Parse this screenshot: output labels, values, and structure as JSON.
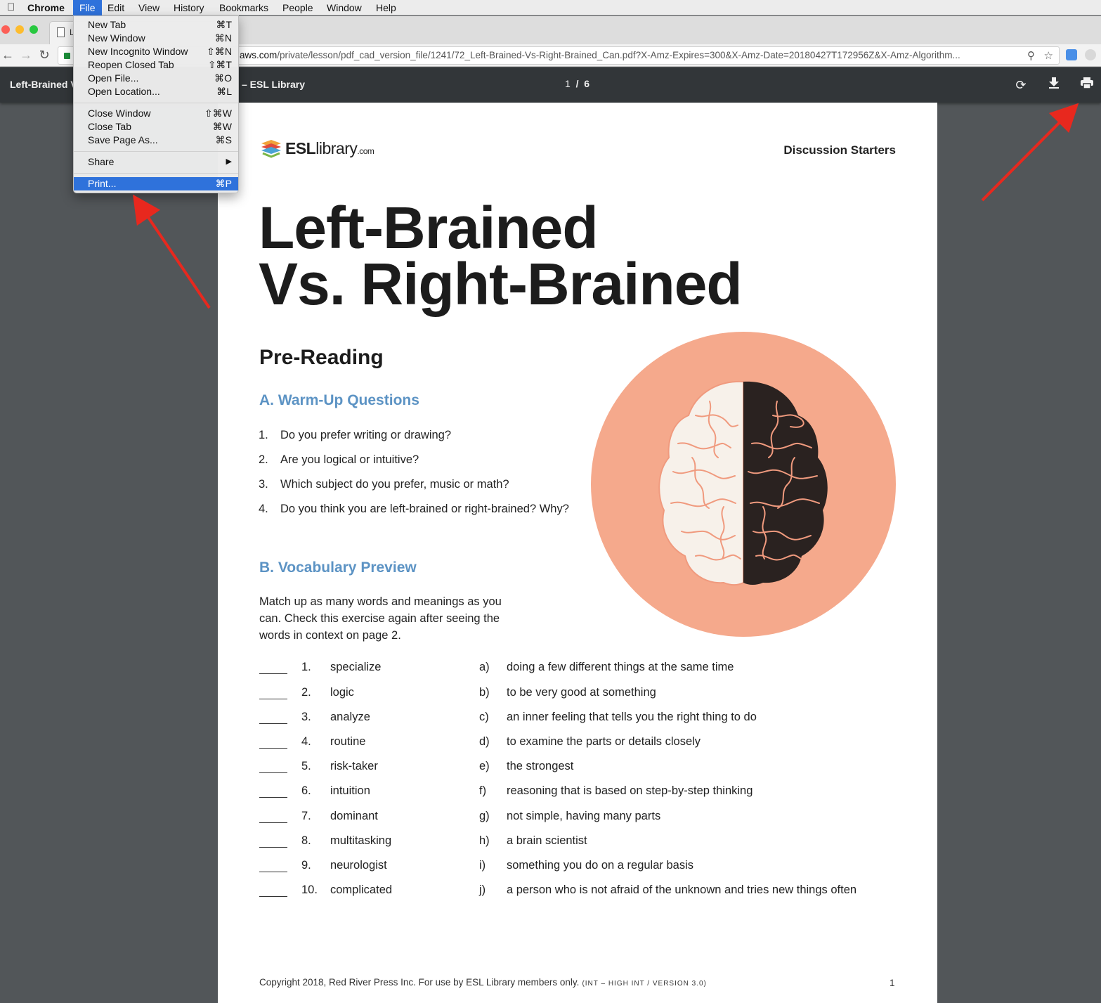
{
  "menubar": {
    "app": "Chrome",
    "items": [
      "File",
      "Edit",
      "View",
      "History",
      "Bookmarks",
      "People",
      "Window",
      "Help"
    ],
    "active": "File"
  },
  "tab": {
    "title": "L"
  },
  "toolbar": {
    "url_host": "aws.com",
    "url_path": "/private/lesson/pdf_cad_version_file/1241/72_Left-Brained-Vs-Right-Brained_Can.pdf?X-Amz-Expires=300&X-Amz-Date=20180427T172956Z&X-Amz-Algorithm..."
  },
  "pdf_toolbar": {
    "title_left": "Left-Brained V",
    "title_right": "– ESL Library",
    "current_page": "1",
    "separator": "/",
    "total_pages": "6"
  },
  "file_menu": [
    {
      "label": "New Tab",
      "shortcut": "⌘T"
    },
    {
      "label": "New Window",
      "shortcut": "⌘N"
    },
    {
      "label": "New Incognito Window",
      "shortcut": "⇧⌘N"
    },
    {
      "label": "Reopen Closed Tab",
      "shortcut": "⇧⌘T"
    },
    {
      "label": "Open File...",
      "shortcut": "⌘O"
    },
    {
      "label": "Open Location...",
      "shortcut": "⌘L"
    },
    {
      "label": "Close Window",
      "shortcut": "⇧⌘W"
    },
    {
      "label": "Close Tab",
      "shortcut": "⌘W"
    },
    {
      "label": "Save Page As...",
      "shortcut": "⌘S"
    },
    {
      "label": "Share",
      "shortcut": "▶"
    },
    {
      "label": "Print...",
      "shortcut": "⌘P"
    }
  ],
  "document": {
    "logo": {
      "esl": "ESL",
      "library": "library",
      "com": ".com"
    },
    "header_right": "Discussion Starters",
    "title_line1": "Left-Brained",
    "title_line2": "Vs. Right-Brained",
    "pre_reading": "Pre-Reading",
    "section_a": "A. Warm-Up Questions",
    "questions": [
      {
        "n": "1.",
        "text": "Do you prefer writing or drawing?"
      },
      {
        "n": "2.",
        "text": "Are you logical or intuitive?"
      },
      {
        "n": "3.",
        "text": "Which subject do you prefer, music or math?"
      },
      {
        "n": "4.",
        "text": "Do you think you are left-brained or right-brained? Why?"
      }
    ],
    "section_b": "B. Vocabulary Preview",
    "instructions": "Match up as many words and meanings as you can. Check this exercise again after seeing the words in context on page 2.",
    "vocab": [
      {
        "n": "1.",
        "word": "specialize",
        "letter": "a)",
        "def": "doing a few different things at the same time"
      },
      {
        "n": "2.",
        "word": "logic",
        "letter": "b)",
        "def": "to be very good at something"
      },
      {
        "n": "3.",
        "word": "analyze",
        "letter": "c)",
        "def": "an inner feeling that tells you the right thing to do"
      },
      {
        "n": "4.",
        "word": "routine",
        "letter": "d)",
        "def": "to examine the parts or details closely"
      },
      {
        "n": "5.",
        "word": "risk-taker",
        "letter": "e)",
        "def": "the strongest"
      },
      {
        "n": "6.",
        "word": "intuition",
        "letter": "f)",
        "def": "reasoning that is based on step-by-step thinking"
      },
      {
        "n": "7.",
        "word": "dominant",
        "letter": "g)",
        "def": "not simple, having many parts"
      },
      {
        "n": "8.",
        "word": "multitasking",
        "letter": "h)",
        "def": "a brain scientist"
      },
      {
        "n": "9.",
        "word": "neurologist",
        "letter": "i)",
        "def": "something you do on a regular basis"
      },
      {
        "n": "10.",
        "word": "complicated",
        "letter": "j)",
        "def": "a person who is not afraid of the unknown and tries new things often"
      }
    ],
    "footer": "Copyright 2018, Red River Press Inc. For use by ESL Library members only.",
    "footer_level": "(INT – HIGH INT / VERSION 3.0)",
    "page_number": "1"
  },
  "colors": {
    "accent_blue": "#5c93c4",
    "menu_highlight": "#2f72db",
    "brain_circle": "#f5a98c",
    "arrow": "#e8281e"
  }
}
